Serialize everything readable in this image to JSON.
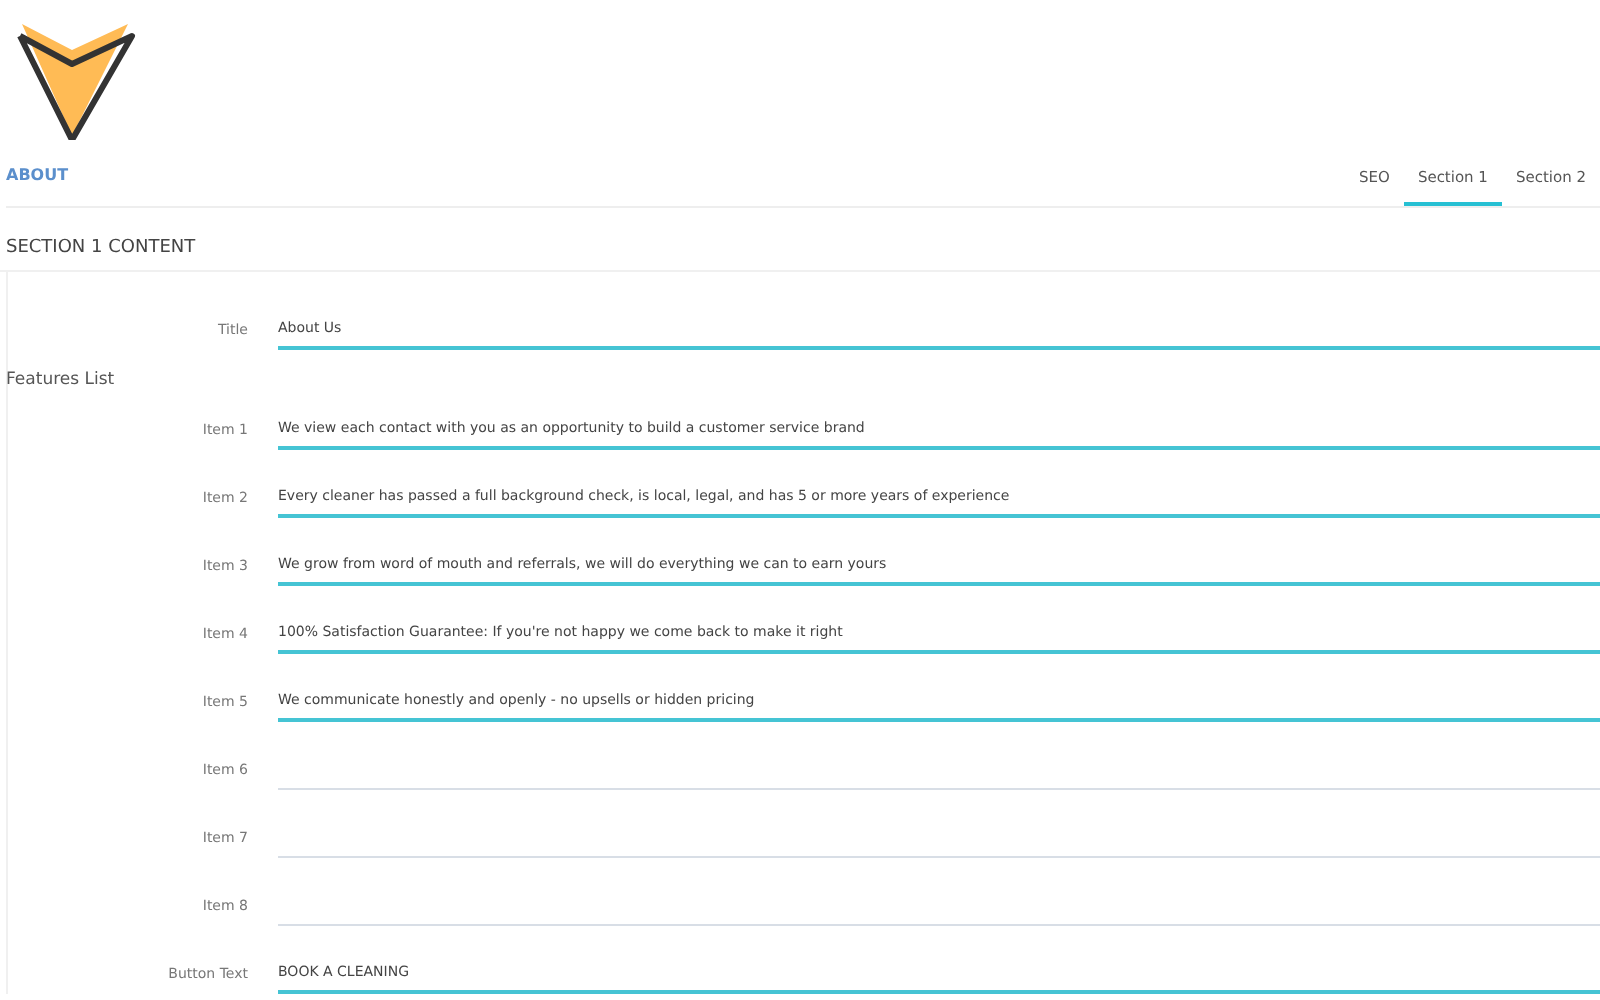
{
  "header": {
    "title": "ABOUT"
  },
  "tabs": [
    {
      "label": "SEO",
      "selected": false
    },
    {
      "label": "Section 1",
      "selected": true
    },
    {
      "label": "Section 2",
      "selected": false
    }
  ],
  "section": {
    "title": "SECTION 1 CONTENT",
    "title_field": {
      "label": "Title",
      "value": "About Us"
    },
    "features_heading": "Features List",
    "items": [
      {
        "label": "Item 1",
        "value": "We view each contact with you as an opportunity to build a customer service brand"
      },
      {
        "label": "Item 2",
        "value": "Every cleaner has passed a full background check, is local, legal, and has 5 or more years of experience"
      },
      {
        "label": "Item 3",
        "value": "We grow from word of mouth and referrals, we will do everything we can to earn yours"
      },
      {
        "label": "Item 4",
        "value": "100% Satisfaction Guarantee: If you're not happy we come back to make it right"
      },
      {
        "label": "Item 5",
        "value": "We communicate honestly and openly - no upsells or hidden pricing"
      },
      {
        "label": "Item 6"
      },
      {
        "label": "Item 7"
      },
      {
        "label": "Item 8"
      }
    ],
    "button_field": {
      "label": "Button Text",
      "value": "BOOK A CLEANING"
    }
  }
}
